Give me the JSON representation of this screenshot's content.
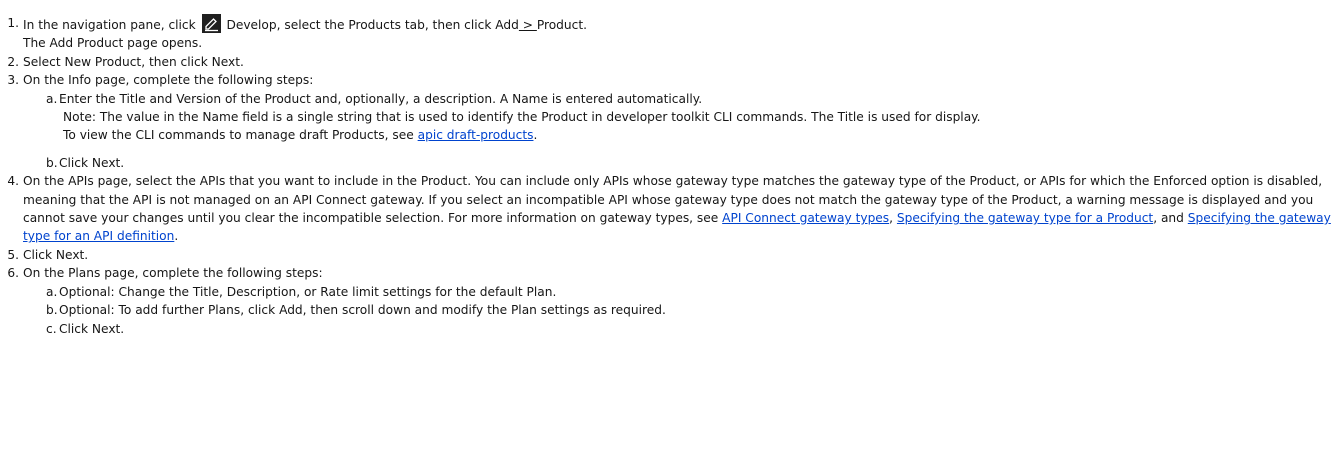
{
  "steps": [
    {
      "num": "1.",
      "before_icon": "In the navigation pane, click ",
      "icon": "pencil-edit-icon",
      "after_icon": " Develop, select the Products tab, then click Add",
      "chevron": " > ",
      "end": "Product.",
      "result": "The Add Product page opens."
    },
    {
      "num": "2.",
      "text": "Select New Product, then click Next."
    },
    {
      "num": "3.",
      "text": "On the Info page, complete the following steps:",
      "sub": [
        {
          "letter": "a.",
          "text": "Enter the Title and Version of the Product and, optionally, a description. A Name is entered automatically.",
          "note": "Note: The value in the Name field is a single string that is used to identify the Product in developer toolkit CLI commands. The Title is used for display.",
          "view_prefix": "To view the CLI commands to manage draft Products, see ",
          "view_link": "apic draft-products",
          "view_suffix": "."
        },
        {
          "letter": "b.",
          "text": "Click Next."
        }
      ]
    },
    {
      "num": "4.",
      "text": "On the APIs page, select the APIs that you want to include in the Product. You can include only APIs whose gateway type matches the gateway type of the Product, or APIs for which the Enforced option is disabled, meaning that the API is not managed on an API Connect gateway. If you select an incompatible API whose gateway type does not match the gateway type of the Product, a warning message is displayed and you cannot save your changes until you clear the incompatible selection. For more information on gateway types, see ",
      "link1": "API Connect gateway types",
      "sep1": ", ",
      "link2": "Specifying the gateway type for a Product",
      "sep2": ", and ",
      "link3": "Specifying the gateway type for an API definition",
      "end": "."
    },
    {
      "num": "5.",
      "text": "Click Next."
    },
    {
      "num": "6.",
      "text": "On the Plans page, complete the following steps:",
      "sub": [
        {
          "letter": "a.",
          "text": "Optional: Change the Title, Description, or Rate limit settings for the default Plan."
        },
        {
          "letter": "b.",
          "text": "Optional: To add further Plans, click Add, then scroll down and modify the Plan settings as required."
        },
        {
          "letter": "c.",
          "text": "Click Next."
        }
      ]
    }
  ]
}
